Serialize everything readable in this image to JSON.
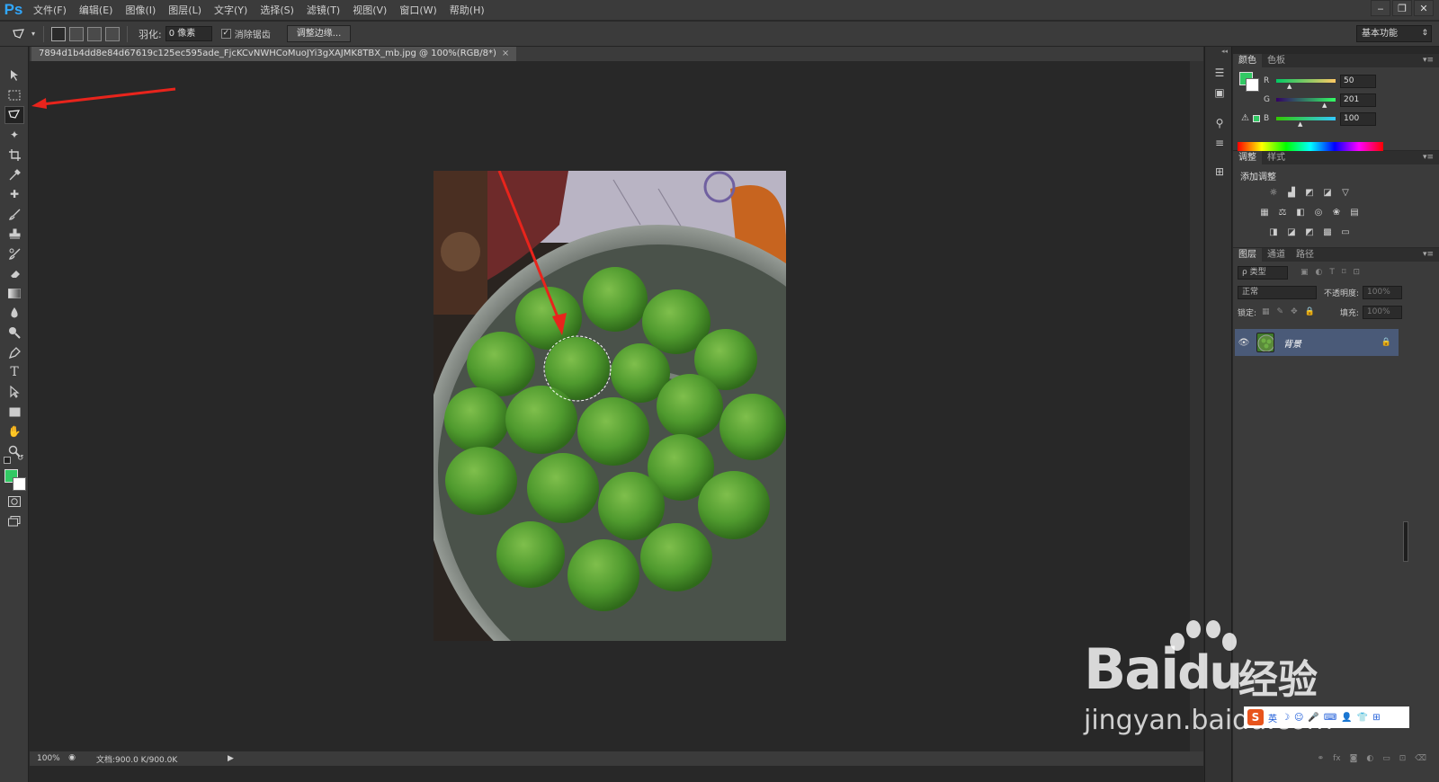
{
  "app": {
    "logo": "Ps"
  },
  "menu": [
    "文件(F)",
    "编辑(E)",
    "图像(I)",
    "图层(L)",
    "文字(Y)",
    "选择(S)",
    "滤镜(T)",
    "视图(V)",
    "窗口(W)",
    "帮助(H)"
  ],
  "window_controls": {
    "minimize": "‒",
    "restore": "❐",
    "close": "✕"
  },
  "options": {
    "feather_label": "羽化:",
    "feather_value": "0 像素",
    "antialias_label": "消除锯齿",
    "antialias_checked": "✓",
    "refine_edge_button": "调整边缘...",
    "workspace": "基本功能"
  },
  "document": {
    "tab_title": "7894d1b4dd8e84d67619c125ec595ade_FjcKCvNWHCoMuoJYi3gXAJMK8TBX_mb.jpg @ 100%(RGB/8*)",
    "close": "×"
  },
  "status": {
    "zoom": "100%",
    "doc_size": "文档:900.0 K/900.0K",
    "arrow": "▶"
  },
  "colors": {
    "foreground": "#32c964",
    "background": "#ffffff",
    "arrow_red": "#e8241c"
  },
  "color_panel": {
    "tabs": [
      "颜色",
      "色板"
    ],
    "channels": [
      {
        "label": "R",
        "value": "50"
      },
      {
        "label": "G",
        "value": "201"
      },
      {
        "label": "B",
        "value": "100"
      }
    ]
  },
  "adjust_panel": {
    "tabs": [
      "调整",
      "样式"
    ],
    "title": "添加调整"
  },
  "layers_panel": {
    "tabs": [
      "图层",
      "通道",
      "路径"
    ],
    "kind_filter": "ρ 类型",
    "blend_mode": "正常",
    "opacity_label": "不透明度:",
    "opacity_value": "100%",
    "lock_label": "锁定:",
    "fill_label": "填充:",
    "fill_value": "100%",
    "layers": [
      {
        "name": "背景",
        "visible": "👁"
      }
    ]
  },
  "watermark": {
    "brand": "Bai",
    "paw": "du",
    "jingyan": "经验",
    "url": "jingyan.baidu.com"
  },
  "ime": {
    "logo": "S",
    "lang": "英"
  }
}
